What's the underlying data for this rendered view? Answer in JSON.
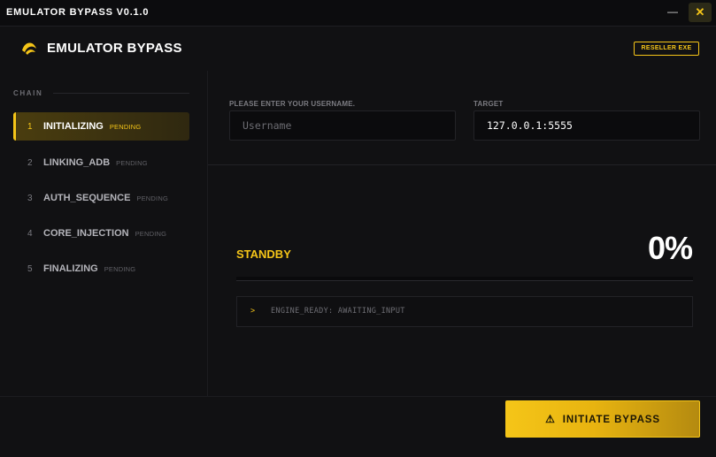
{
  "window": {
    "title": "EMULATOR BYPASS V0.1.0",
    "minimize_glyph": "—",
    "close_glyph": "✕"
  },
  "header": {
    "logo_icon": "crescent-logo-icon",
    "app_name": "EMULATOR BYPASS",
    "badge": "RESELLER EXE"
  },
  "sidebar": {
    "section_label": "CHAIN",
    "steps": [
      {
        "num": "1",
        "name": "INITIALIZING",
        "state": "PENDING",
        "active": true
      },
      {
        "num": "2",
        "name": "LINKING_ADB",
        "state": "PENDING",
        "active": false
      },
      {
        "num": "3",
        "name": "AUTH_SEQUENCE",
        "state": "PENDING",
        "active": false
      },
      {
        "num": "4",
        "name": "CORE_INJECTION",
        "state": "PENDING",
        "active": false
      },
      {
        "num": "5",
        "name": "FINALIZING",
        "state": "PENDING",
        "active": false
      }
    ]
  },
  "form": {
    "username_label": "PLEASE ENTER YOUR USERNAME.",
    "username_placeholder": "Username",
    "username_value": "",
    "target_label": "TARGET",
    "target_value": "127.0.0.1:5555"
  },
  "progress": {
    "status": "STANDBY",
    "percent_text": "0%",
    "fraction": 0
  },
  "console": {
    "prompt": ">",
    "line": "ENGINE_READY: AWAITING_INPUT"
  },
  "actions": {
    "bypass_icon": "warning-triangle-icon",
    "bypass_glyph": "⚠",
    "bypass_label": "INITIATE BYPASS"
  },
  "colors": {
    "accent": "#f5c518",
    "background": "#111113"
  }
}
